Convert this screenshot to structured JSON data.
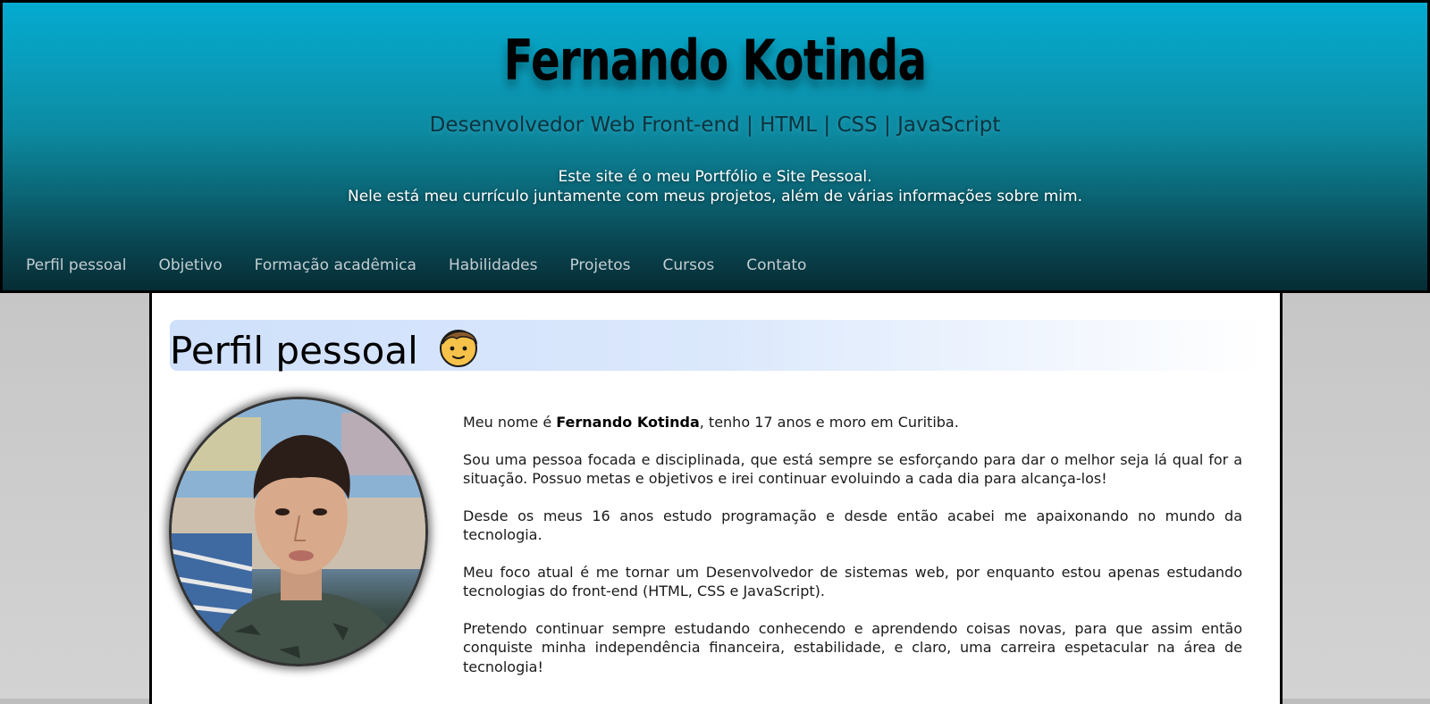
{
  "header": {
    "title": "Fernando Kotinda",
    "subtitle": "Desenvolvedor Web Front-end | HTML | CSS | JavaScript",
    "intro_line1": "Este site é o meu Portfólio e Site Pessoal.",
    "intro_line2": "Nele está meu currículo juntamente com meus projetos, além de várias informações sobre mim."
  },
  "nav": {
    "items": [
      {
        "label": "Perfil pessoal"
      },
      {
        "label": "Objetivo"
      },
      {
        "label": "Formação acadêmica"
      },
      {
        "label": "Habilidades"
      },
      {
        "label": "Projetos"
      },
      {
        "label": "Cursos"
      },
      {
        "label": "Contato"
      }
    ]
  },
  "profile": {
    "heading": "Perfil pessoal",
    "heading_emoji": "boy-face-icon",
    "photo_icon": "profile-photo",
    "p1_prefix": "Meu nome é ",
    "p1_name": "Fernando Kotinda",
    "p1_suffix": ", tenho 17 anos e moro em Curitiba.",
    "p2": "Sou uma pessoa focada e disciplinada, que está sempre se esforçando para dar o melhor seja lá qual for a situação. Possuo metas e objetivos e irei continuar evoluindo a cada dia para alcança-los!",
    "p3": "Desde os meus 16 anos estudo programação e desde então acabei me apaixonando no mundo da tecnologia.",
    "p4": "Meu foco atual é me tornar um Desenvolvedor de sistemas web, por enquanto estou apenas estudando tecnologias do front-end (HTML, CSS e JavaScript).",
    "p5": "Pretendo continuar sempre estudando conhecendo e aprendendo coisas novas, para que assim então conquiste minha independência financeira, estabilidade, e claro, uma carreira espetacular na área de tecnologia!"
  },
  "colors": {
    "header_top": "#04abd0",
    "header_bottom": "#062d35",
    "nav_text": "#c3ced3",
    "heading_bg": "#cfe0fb"
  }
}
